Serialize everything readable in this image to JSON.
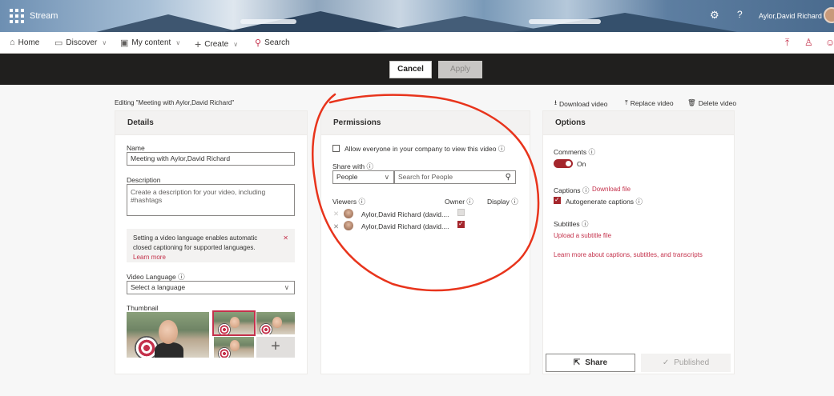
{
  "app": {
    "name": "Stream",
    "user_name": "Aylor,David Richard"
  },
  "nav": {
    "home": "Home",
    "discover": "Discover",
    "my_content": "My content",
    "create": "Create",
    "search": "Search"
  },
  "actions": {
    "cancel": "Cancel",
    "apply": "Apply"
  },
  "editing_label": "Editing \"Meeting with Aylor,David Richard\"",
  "video_actions": {
    "download": "Download video",
    "replace": "Replace video",
    "delete": "Delete video"
  },
  "details": {
    "heading": "Details",
    "name_label": "Name",
    "name_value": "Meeting with Aylor,David Richard",
    "description_label": "Description",
    "description_placeholder": "Create a description for your video, including #hashtags",
    "language_info_text": "Setting a video language enables automatic closed captioning for supported languages.",
    "language_info_link": "Learn more",
    "video_language_label": "Video Language",
    "video_language_value": "Select a language",
    "thumbnail_label": "Thumbnail"
  },
  "permissions": {
    "heading": "Permissions",
    "allow_everyone": "Allow everyone in your company to view this video",
    "share_with_label": "Share with",
    "share_with_value": "People",
    "search_placeholder": "Search for People",
    "viewers_label": "Viewers",
    "owner_label": "Owner",
    "display_label": "Display",
    "viewers": [
      {
        "name": "Aylor,David Richard (david....",
        "owner": false
      },
      {
        "name": "Aylor,David Richard (david....",
        "owner": true
      }
    ]
  },
  "options": {
    "heading": "Options",
    "comments_label": "Comments",
    "comments_state": "On",
    "captions_label": "Captions",
    "download_file": "Download file",
    "autogenerate_captions": "Autogenerate captions",
    "subtitles_label": "Subtitles",
    "upload_subtitle": "Upload a subtitle file",
    "learn_more": "Learn more about captions, subtitles, and transcripts",
    "share_button": "Share",
    "published_button": "Published"
  },
  "colors": {
    "accent": "#a4262c",
    "link": "#c4314b",
    "actionbar": "#201f1e",
    "annotation": "#e8341c"
  }
}
